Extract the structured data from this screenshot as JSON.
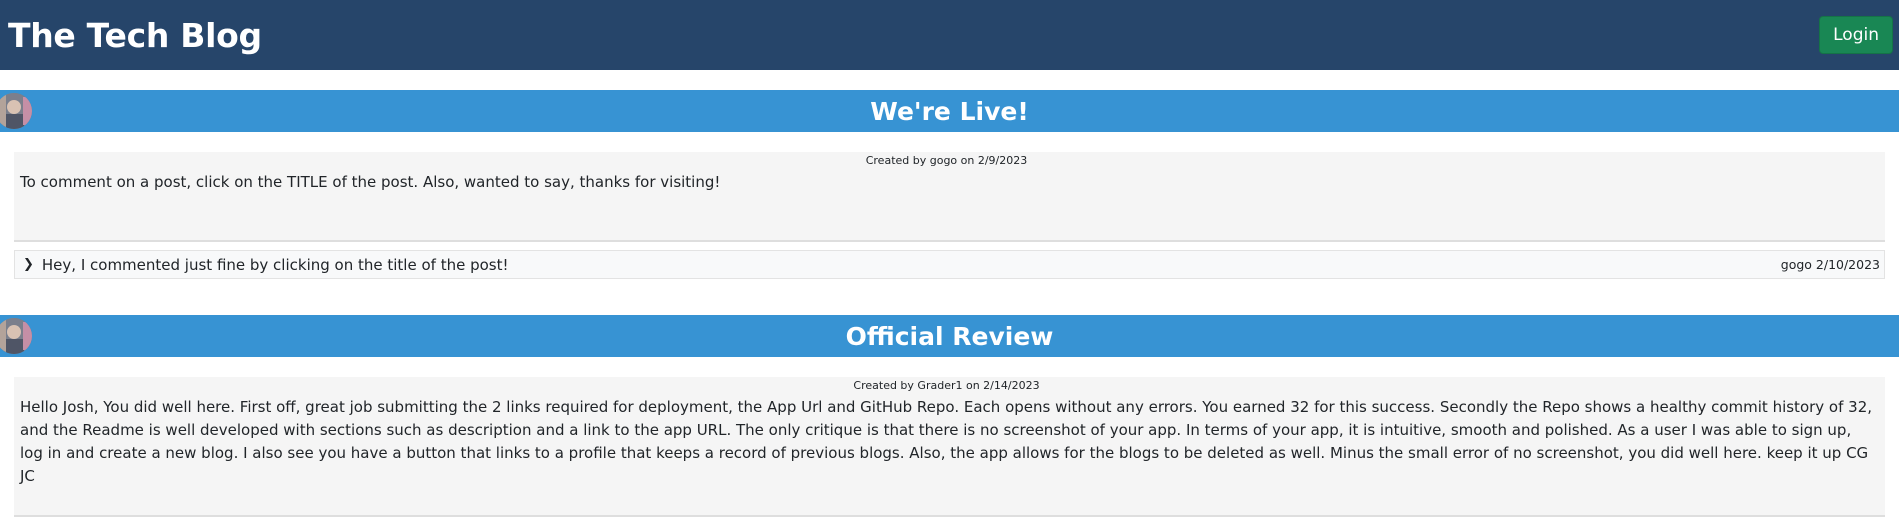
{
  "header": {
    "title": "The Tech Blog",
    "login_label": "Login",
    "colors": {
      "navbar": "#26456a",
      "login": "#198754"
    }
  },
  "posts": [
    {
      "avatar_icon": "user-avatar",
      "title": "We're Live!",
      "meta": "Created by gogo on 2/9/2023",
      "body": "To comment on a post, click on the TITLE of the post. Also, wanted to say, thanks for visiting!",
      "comments": [
        {
          "text": "Hey, I commented just fine by clicking on the title of the post!",
          "meta": "gogo 2/10/2023",
          "icon": "chevron-right-icon"
        }
      ]
    },
    {
      "avatar_icon": "user-avatar",
      "title": "Official Review",
      "meta": "Created by Grader1 on 2/14/2023",
      "body": "Hello Josh, You did well here. First off, great job submitting the 2 links required for deployment, the App Url and GitHub Repo. Each opens without any errors. You earned 32 for this success. Secondly the Repo shows a healthy commit history of 32, and the Readme is well developed with sections such as description and a link to the app URL. The only critique is that there is no screenshot of your app. In terms of your app, it is intuitive, smooth and polished. As a user I was able to sign up, log in and create a new blog. I also see you have a button that links to a profile that keeps a record of previous blogs. Also, the app allows for the blogs to be deleted as well. Minus the small error of no screenshot, you did well here. keep it up CG JC",
      "comments": []
    }
  ],
  "theme": {
    "post_title_bar": "#3793d3",
    "content_bg": "#f5f5f5"
  }
}
